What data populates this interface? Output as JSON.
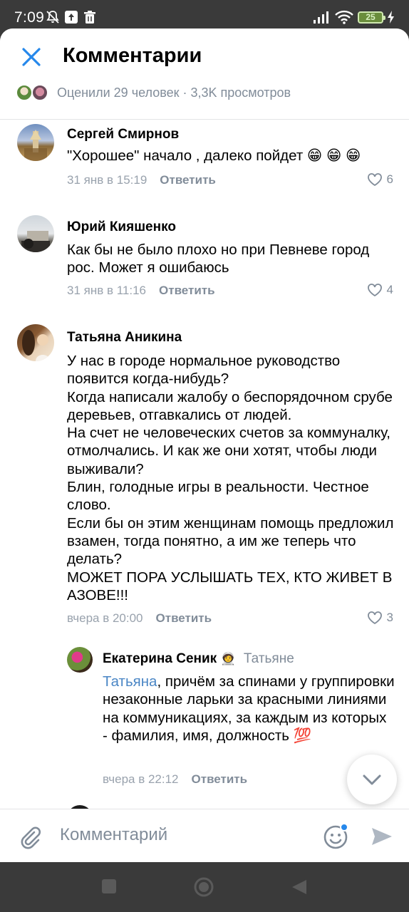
{
  "status_bar": {
    "time": "7:09",
    "battery": "25"
  },
  "header": {
    "title": "Комментарии",
    "stats": "Оценили 29 человек · 3,3K просмотров"
  },
  "comments": [
    {
      "author": "Сергей Смирнов",
      "text": "\"Хорошее\" начало , далеко пойдет 😁 😁 😁",
      "date": "31 янв в 15:19",
      "reply": "Ответить",
      "likes": "6"
    },
    {
      "author": "Юрий Кияшенко",
      "text": "Как бы не было плохо но при Певневе город рос. Может я ошибаюсь",
      "date": "31 янв в 11:16",
      "reply": "Ответить",
      "likes": "4"
    },
    {
      "author": "Татьяна Аникина",
      "text": "У нас в городе нормальное руководство появится когда-нибудь?\nКогда написали жалобу о беспорядочном срубе деревьев, отгавкались от людей.\nНа счет не человеческих счетов за коммуналку, отмолчались. И как же они хотят, чтобы люди выживали?\nБлин, голодные игры в реальности. Честное слово.\nЕсли бы он этим женщинам помощь предложил взамен, тогда понятно, а им же теперь что делать?\nМОЖЕТ ПОРА УСЛЫШАТЬ ТЕХ, КТО ЖИВЕТ В АЗОВЕ!!!",
      "date": "вчера в 20:00",
      "reply": "Ответить",
      "likes": "3"
    },
    {
      "author": "Екатерина Сеник",
      "author_badge": "🧑‍🚀",
      "reply_to": "Татьяне",
      "mention": "Татьяна",
      "text": ", причём за спинами у группировки незаконные ларьки за красными линиями на коммуникациях, за каждым из которых - фамилия, имя, должность 💯",
      "date": "вчера в 22:12",
      "reply": "Ответить"
    }
  ],
  "composer": {
    "placeholder": "Комментарий"
  },
  "colors": {
    "accent": "#2688eb",
    "secondary": "#818c99",
    "text": "#000000"
  }
}
